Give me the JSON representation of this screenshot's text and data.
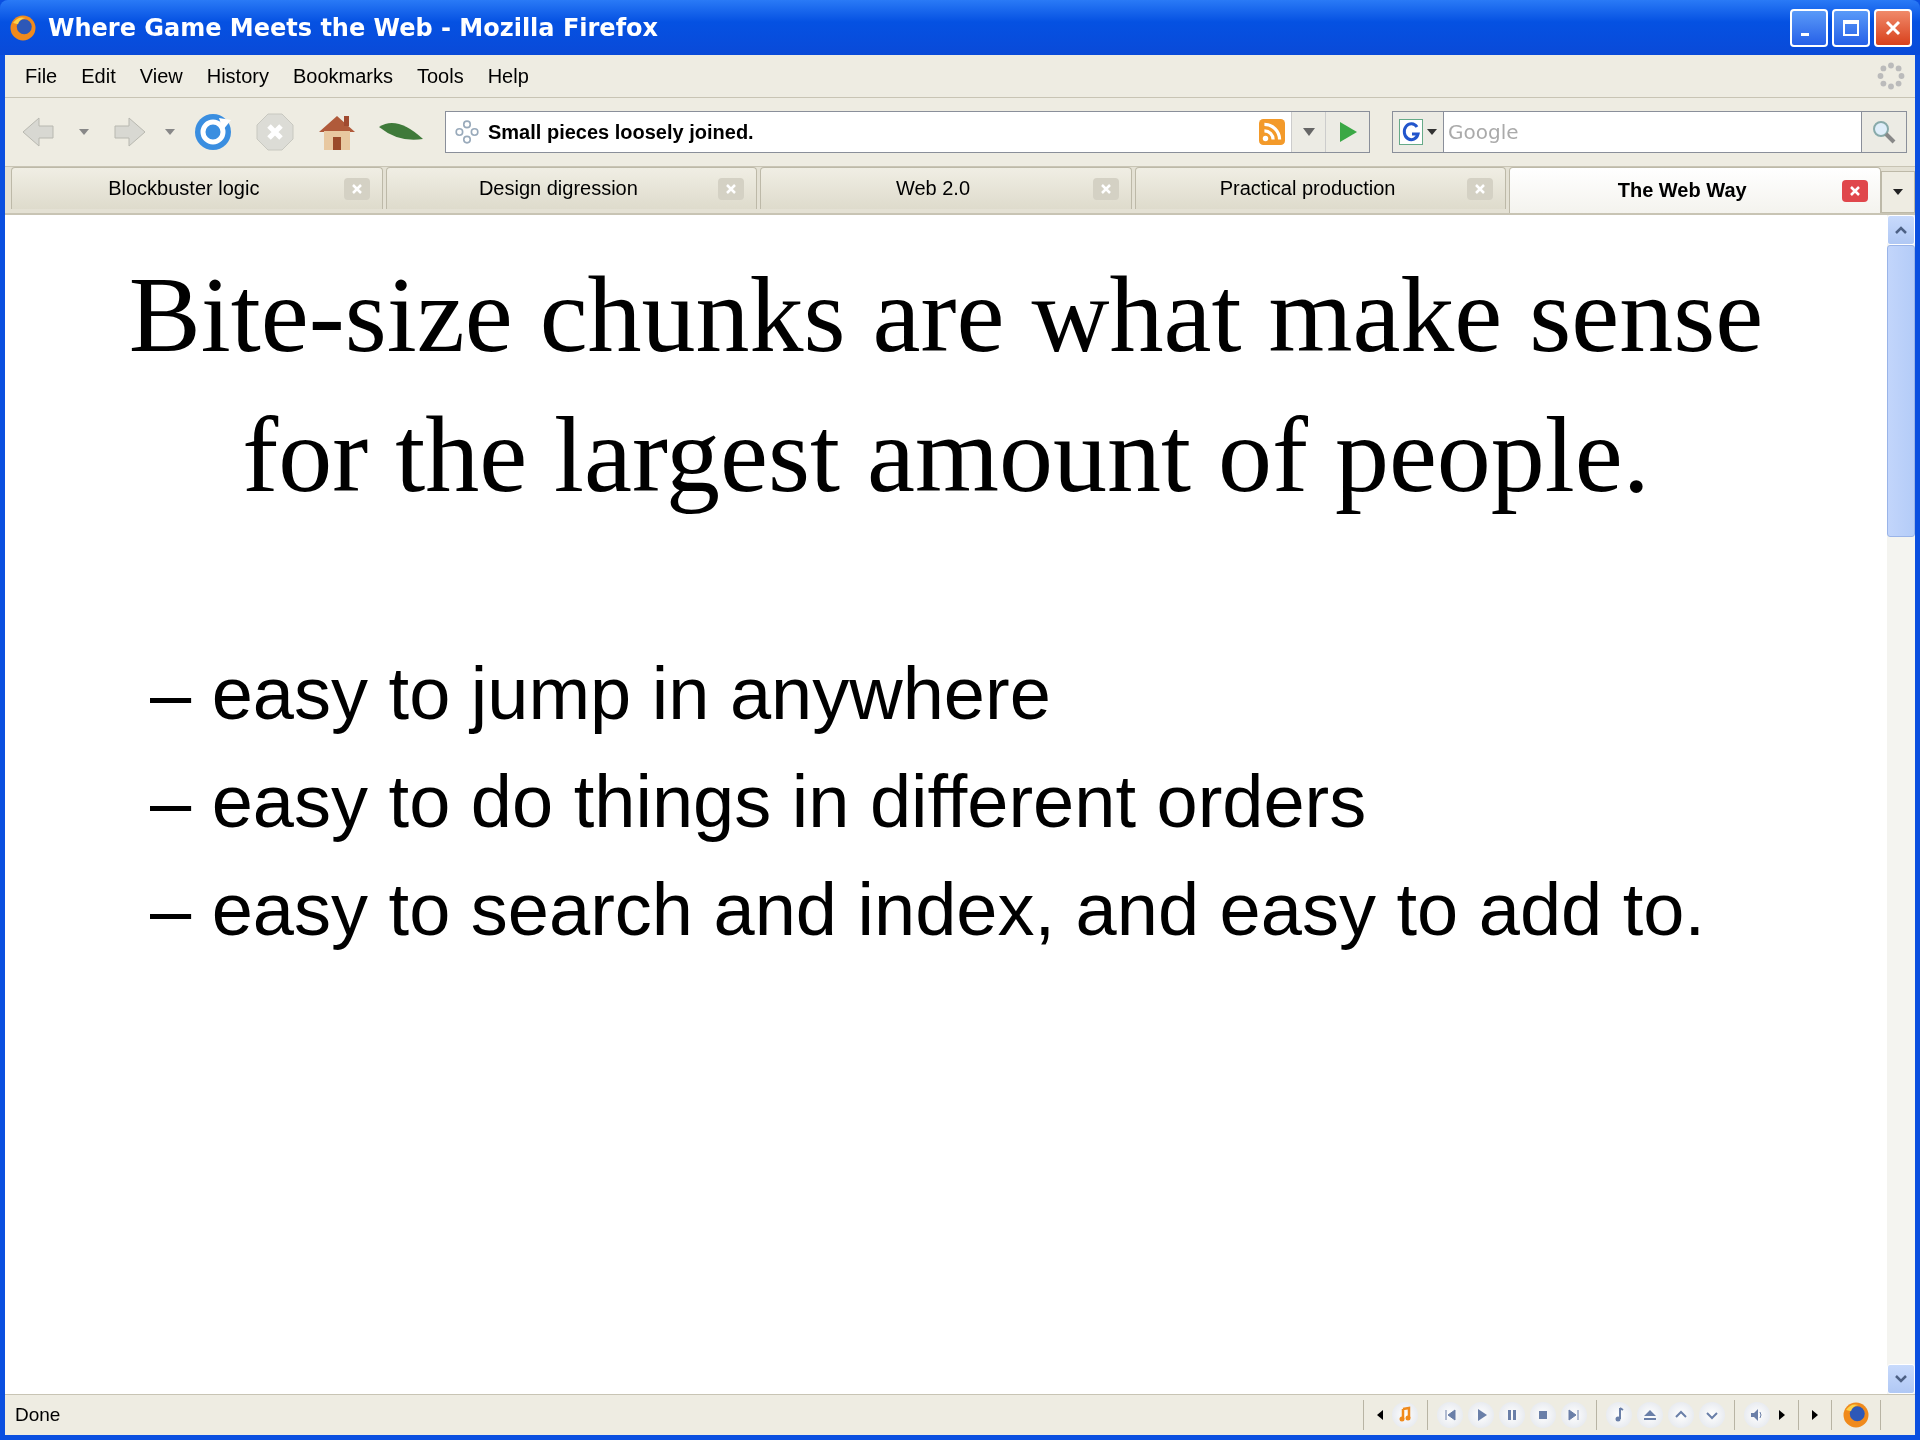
{
  "window": {
    "title": "Where Game Meets the Web - Mozilla Firefox"
  },
  "menu": [
    "File",
    "Edit",
    "View",
    "History",
    "Bookmarks",
    "Tools",
    "Help"
  ],
  "address": {
    "value": "Small pieces loosely joined."
  },
  "search": {
    "placeholder": "Google"
  },
  "tabs": [
    {
      "label": "Blockbuster logic",
      "selected": false
    },
    {
      "label": "Design digression",
      "selected": false
    },
    {
      "label": "Web 2.0",
      "selected": false
    },
    {
      "label": "Practical production",
      "selected": false
    },
    {
      "label": "The Web Way",
      "selected": true
    }
  ],
  "slide": {
    "heading": "Bite-size chunks are what make sense for the largest amount of people.",
    "bullets": [
      "– easy to jump in anywhere",
      "– easy to do things in different orders",
      "– easy to search and index, and easy to add to."
    ]
  },
  "status_bar": {
    "text": "Done"
  }
}
